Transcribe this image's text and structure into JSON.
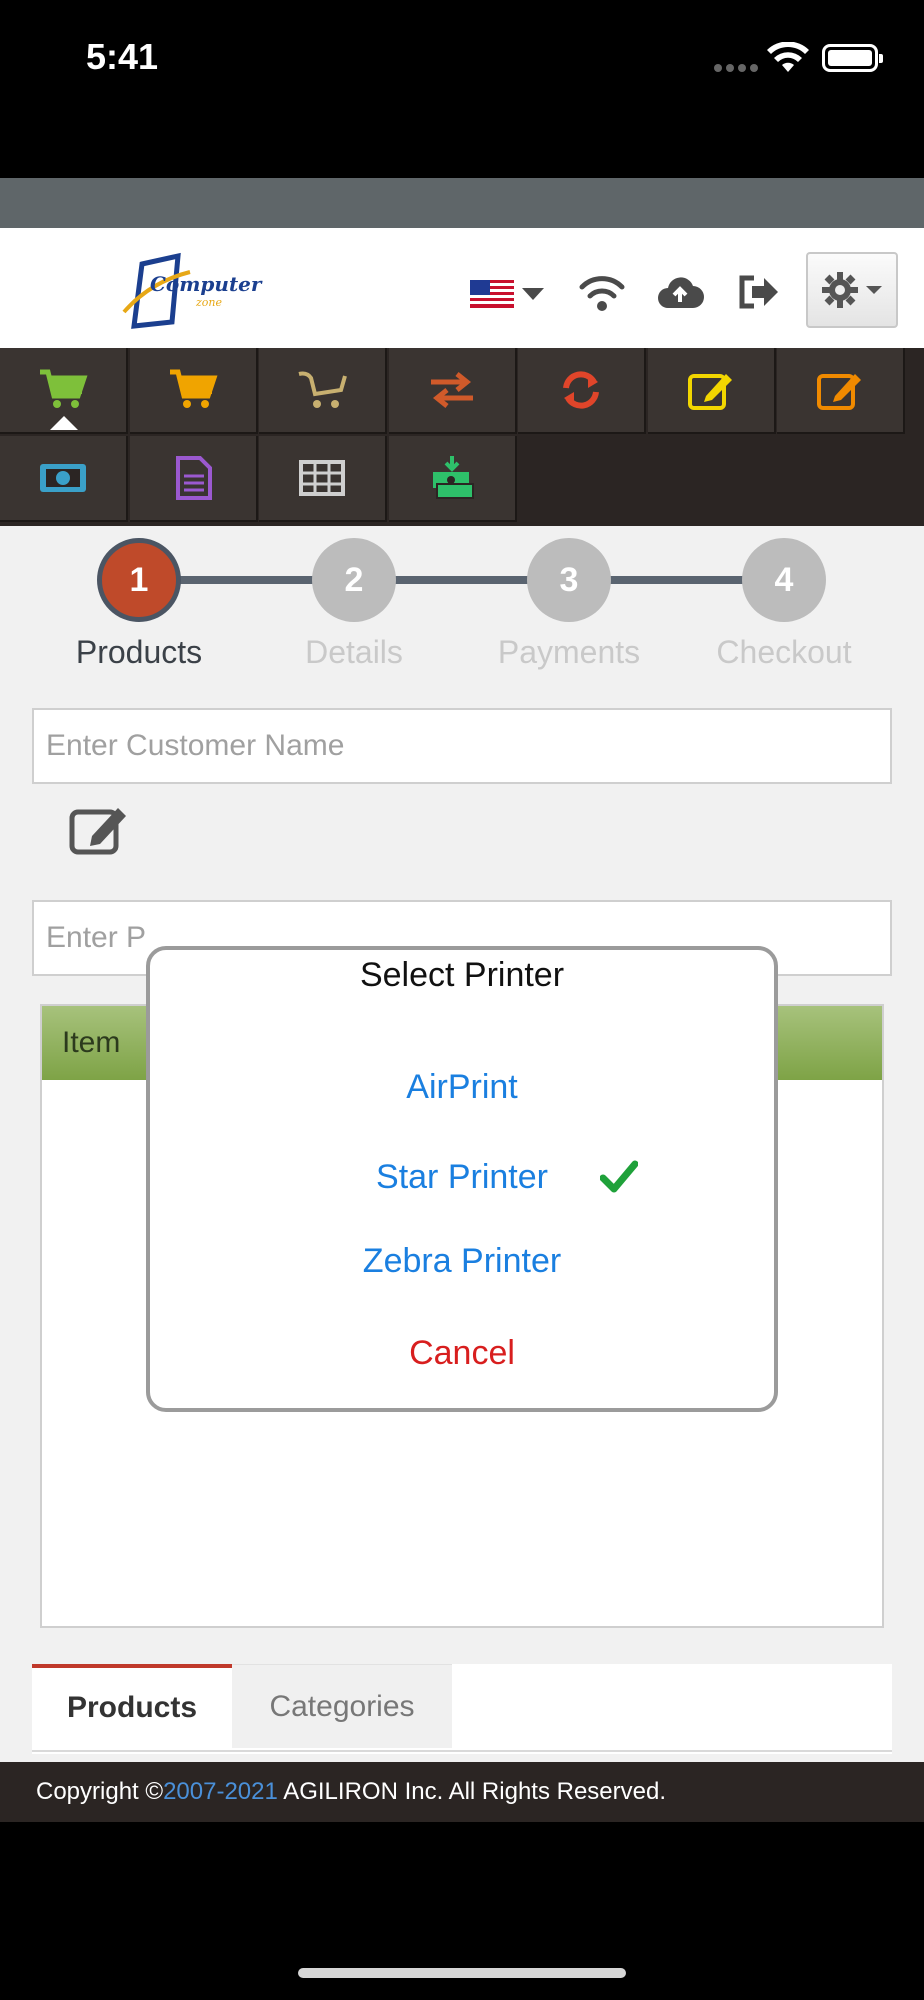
{
  "status_bar": {
    "time": "5:41"
  },
  "header": {
    "logo_text": "Computer",
    "logo_subtext": "zone",
    "language_flag": "us-flag-icon",
    "icons": [
      "wifi-icon",
      "cloud-upload-icon",
      "logout-icon",
      "gear-icon"
    ]
  },
  "toolbar": {
    "items": [
      {
        "icon": "cart-icon",
        "color": "#7ec03a"
      },
      {
        "icon": "cart-icon",
        "color": "#f0a400"
      },
      {
        "icon": "cart-outline-icon",
        "color": "#c8b070"
      },
      {
        "icon": "transfer-arrows-icon",
        "color": "#d05a2a"
      },
      {
        "icon": "refresh-icon",
        "color": "#e0452a"
      },
      {
        "icon": "edit-icon",
        "color": "#f2d600"
      },
      {
        "icon": "edit-icon",
        "color": "#f08a00"
      },
      {
        "icon": "money-icon",
        "color": "#3aa0c8"
      },
      {
        "icon": "document-icon",
        "color": "#9b59d0"
      },
      {
        "icon": "grid-table-icon",
        "color": "#cfcfcf"
      },
      {
        "icon": "cash-register-icon",
        "color": "#2ec06a"
      }
    ]
  },
  "wizard": {
    "steps": [
      {
        "number": "1",
        "label": "Products"
      },
      {
        "number": "2",
        "label": "Details"
      },
      {
        "number": "3",
        "label": "Payments"
      },
      {
        "number": "4",
        "label": "Checkout"
      }
    ],
    "active_step": 1
  },
  "form": {
    "customer_placeholder": "Enter Customer Name",
    "product_placeholder": "Enter P",
    "items_header": "Item"
  },
  "modal": {
    "title": "Select Printer",
    "options": [
      "AirPrint",
      "Star Printer",
      "Zebra Printer"
    ],
    "selected_option": "Star Printer",
    "cancel_label": "Cancel"
  },
  "tabs": {
    "products": "Products",
    "categories": "Categories"
  },
  "footer": {
    "prefix": "Copyright ©",
    "years": "2007-2021",
    "suffix": " AGILIRON Inc. All Rights Reserved."
  }
}
